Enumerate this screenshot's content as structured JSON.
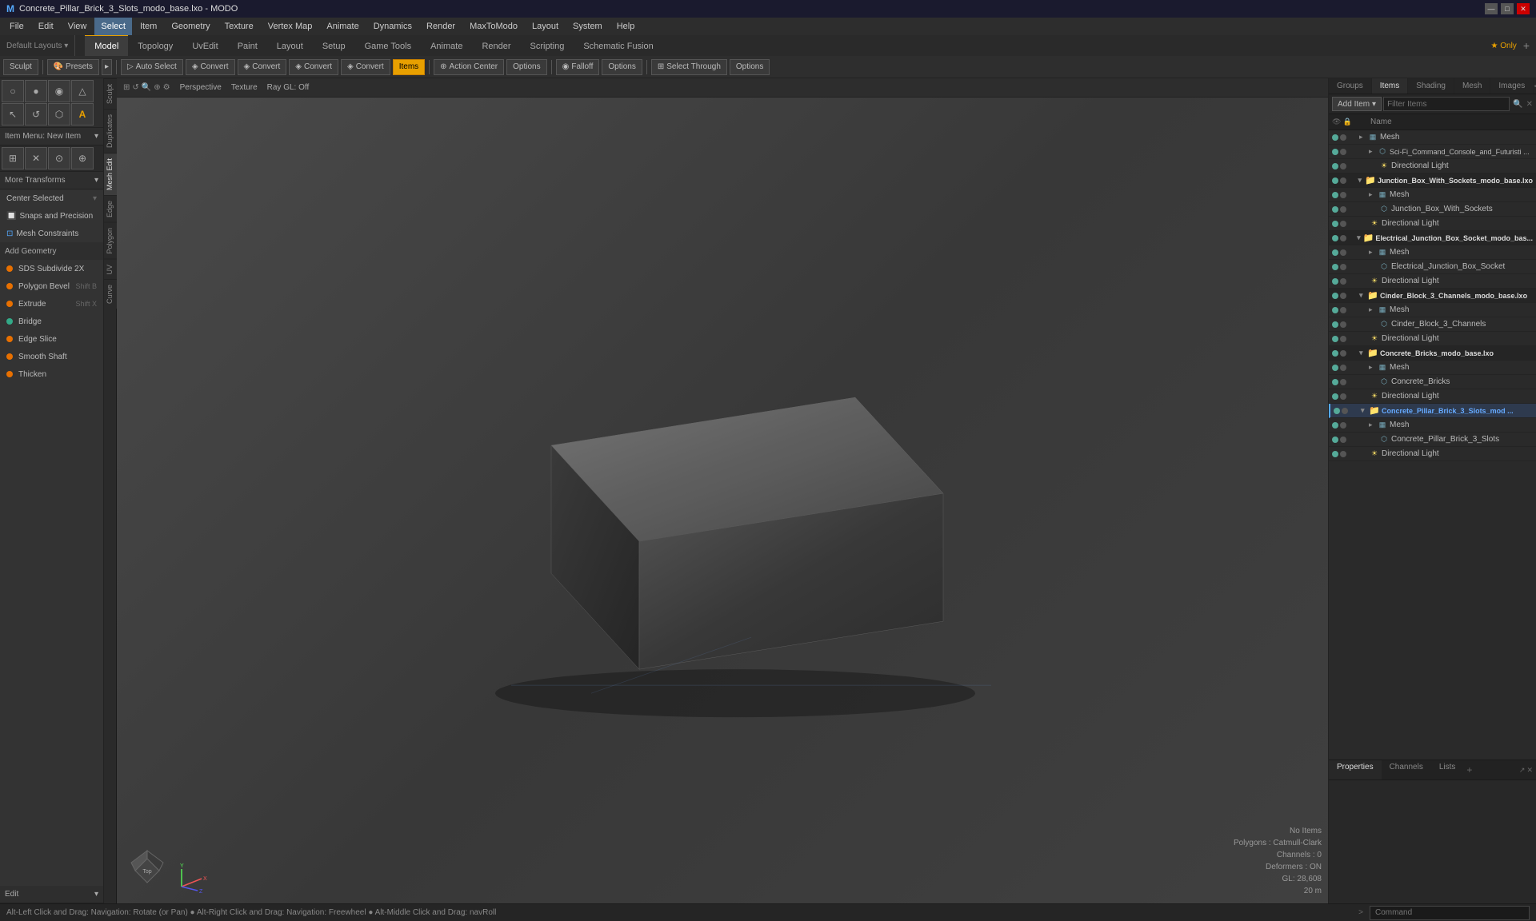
{
  "titlebar": {
    "title": "Concrete_Pillar_Brick_3_Slots_modo_base.lxo - MODO",
    "app": "MODO",
    "controls": [
      "—",
      "□",
      "✕"
    ]
  },
  "menubar": {
    "items": [
      "File",
      "Edit",
      "View",
      "Select",
      "Item",
      "Geometry",
      "Texture",
      "Vertex Map",
      "Animate",
      "Dynamics",
      "Render",
      "MaxToModo",
      "Layout",
      "System",
      "Help"
    ]
  },
  "tabbar": {
    "tabs": [
      "Model",
      "Topology",
      "UvEdit",
      "Paint",
      "Layout",
      "Setup",
      "Game Tools",
      "Animate",
      "Render",
      "Scripting",
      "Schematic Fusion"
    ],
    "active": "Model",
    "right_btn": "★ Only",
    "add_btn": "+"
  },
  "toolbar": {
    "sculpt_label": "Sculpt",
    "presets_label": "Presets",
    "presets_icon": "🎨",
    "convert_btns": [
      "Auto Select",
      "Convert",
      "Convert",
      "Convert",
      "Convert"
    ],
    "items_label": "Items",
    "action_center_label": "Action Center",
    "options_label": "Options",
    "falloff_label": "Falloff",
    "options2_label": "Options",
    "select_through_label": "Select Through",
    "options3_label": "Options"
  },
  "viewport": {
    "mode": "Perspective",
    "shading": "Texture",
    "ray": "Ray GL: Off",
    "info": {
      "no_items": "No Items",
      "polygons": "Polygons : Catmull-Clark",
      "channels": "Channels : 0",
      "deformers": "Deformers : ON",
      "gl": "GL: 28,608",
      "unit": "20 m"
    }
  },
  "left_panel": {
    "icon_rows": [
      [
        "○",
        "●",
        "◉",
        "△"
      ],
      [
        "◯",
        "↺",
        "⬡",
        "A"
      ]
    ],
    "item_menu": "Item Menu: New Item",
    "icon_rows2": [
      [
        "⊞",
        "⊠",
        "⊙",
        "⊕"
      ]
    ],
    "more_transforms": "More Transforms",
    "center_selected": "Center Selected",
    "snaps_precision": "Snaps and Precision",
    "mesh_constraints": "Mesh Constraints",
    "add_geometry": "Add Geometry",
    "tools": [
      {
        "label": "SDS Subdivide 2X",
        "shortcut": "",
        "dot_color": "orange"
      },
      {
        "label": "Polygon Bevel",
        "shortcut": "Shift B",
        "dot_color": "orange"
      },
      {
        "label": "Extrude",
        "shortcut": "Shift X",
        "dot_color": "orange"
      },
      {
        "label": "Bridge",
        "shortcut": "",
        "dot_color": "green"
      },
      {
        "label": "Edge Slice",
        "shortcut": "",
        "dot_color": "orange"
      },
      {
        "label": "Smooth Shaft",
        "shortcut": "",
        "dot_color": "orange"
      },
      {
        "label": "Thicken",
        "shortcut": "",
        "dot_color": "orange"
      }
    ],
    "edit_label": "Edit",
    "side_tabs": [
      "Sculpt",
      "Duplicates",
      "Mesh Edit",
      "Edge",
      "Polygon",
      "UV",
      "Curve"
    ]
  },
  "right_panel": {
    "tabs": [
      "Groups",
      "Items",
      "Shading",
      "Mesh",
      "Images"
    ],
    "active_tab": "Items",
    "add_item_label": "Add Item",
    "filter_items_label": "Filter Items",
    "tree_col": "Name",
    "tree": [
      {
        "level": 0,
        "type": "mesh",
        "label": "Mesh",
        "visible": true
      },
      {
        "level": 1,
        "type": "item",
        "label": "Sci-Fi_Command_Console_and_Futuristi ...",
        "visible": true
      },
      {
        "level": 2,
        "type": "light",
        "label": "Directional Light",
        "visible": true
      },
      {
        "level": 0,
        "type": "folder",
        "label": "Junction_Box_With_Sockets_modo_base.lxo",
        "visible": true,
        "expanded": true
      },
      {
        "level": 1,
        "type": "mesh",
        "label": "Mesh",
        "visible": true
      },
      {
        "level": 1,
        "type": "item",
        "label": "Junction_Box_With_Sockets",
        "visible": true
      },
      {
        "level": 2,
        "type": "light",
        "label": "Directional Light",
        "visible": true
      },
      {
        "level": 0,
        "type": "folder",
        "label": "Electrical_Junction_Box_Socket_modo_bas...",
        "visible": true,
        "expanded": true
      },
      {
        "level": 1,
        "type": "mesh",
        "label": "Mesh",
        "visible": true
      },
      {
        "level": 1,
        "type": "item",
        "label": "Electrical_Junction_Box_Socket",
        "visible": true
      },
      {
        "level": 2,
        "type": "light",
        "label": "Directional Light",
        "visible": true
      },
      {
        "level": 0,
        "type": "folder",
        "label": "Cinder_Block_3_Channels_modo_base.lxo",
        "visible": true,
        "expanded": true
      },
      {
        "level": 1,
        "type": "mesh",
        "label": "Mesh",
        "visible": true
      },
      {
        "level": 1,
        "type": "item",
        "label": "Cinder_Block_3_Channels",
        "visible": true
      },
      {
        "level": 2,
        "type": "light",
        "label": "Directional Light",
        "visible": true
      },
      {
        "level": 0,
        "type": "folder",
        "label": "Concrete_Bricks_modo_base.lxo",
        "visible": true,
        "expanded": true
      },
      {
        "level": 1,
        "type": "mesh",
        "label": "Mesh",
        "visible": true
      },
      {
        "level": 1,
        "type": "item",
        "label": "Concrete_Bricks",
        "visible": true
      },
      {
        "level": 2,
        "type": "light",
        "label": "Directional Light",
        "visible": true
      },
      {
        "level": 0,
        "type": "folder",
        "label": "Concrete_Pillar_Brick_3_Slots_mod ...",
        "visible": true,
        "expanded": true,
        "active": true
      },
      {
        "level": 1,
        "type": "mesh",
        "label": "Mesh",
        "visible": true
      },
      {
        "level": 1,
        "type": "item",
        "label": "Concrete_Pillar_Brick_3_Slots",
        "visible": true
      },
      {
        "level": 2,
        "type": "light",
        "label": "Directional Light",
        "visible": true
      }
    ]
  },
  "right_bottom": {
    "tabs": [
      "Properties",
      "Channels",
      "Lists"
    ],
    "active_tab": "Properties",
    "add_btn": "+"
  },
  "statusbar": {
    "message": "Alt-Left Click and Drag: Navigation: Rotate (or Pan) ● Alt-Right Click and Drag: Navigation: Freewheel ● Alt-Middle Click and Drag: navRoll",
    "arrow": ">",
    "command_placeholder": "Command"
  }
}
